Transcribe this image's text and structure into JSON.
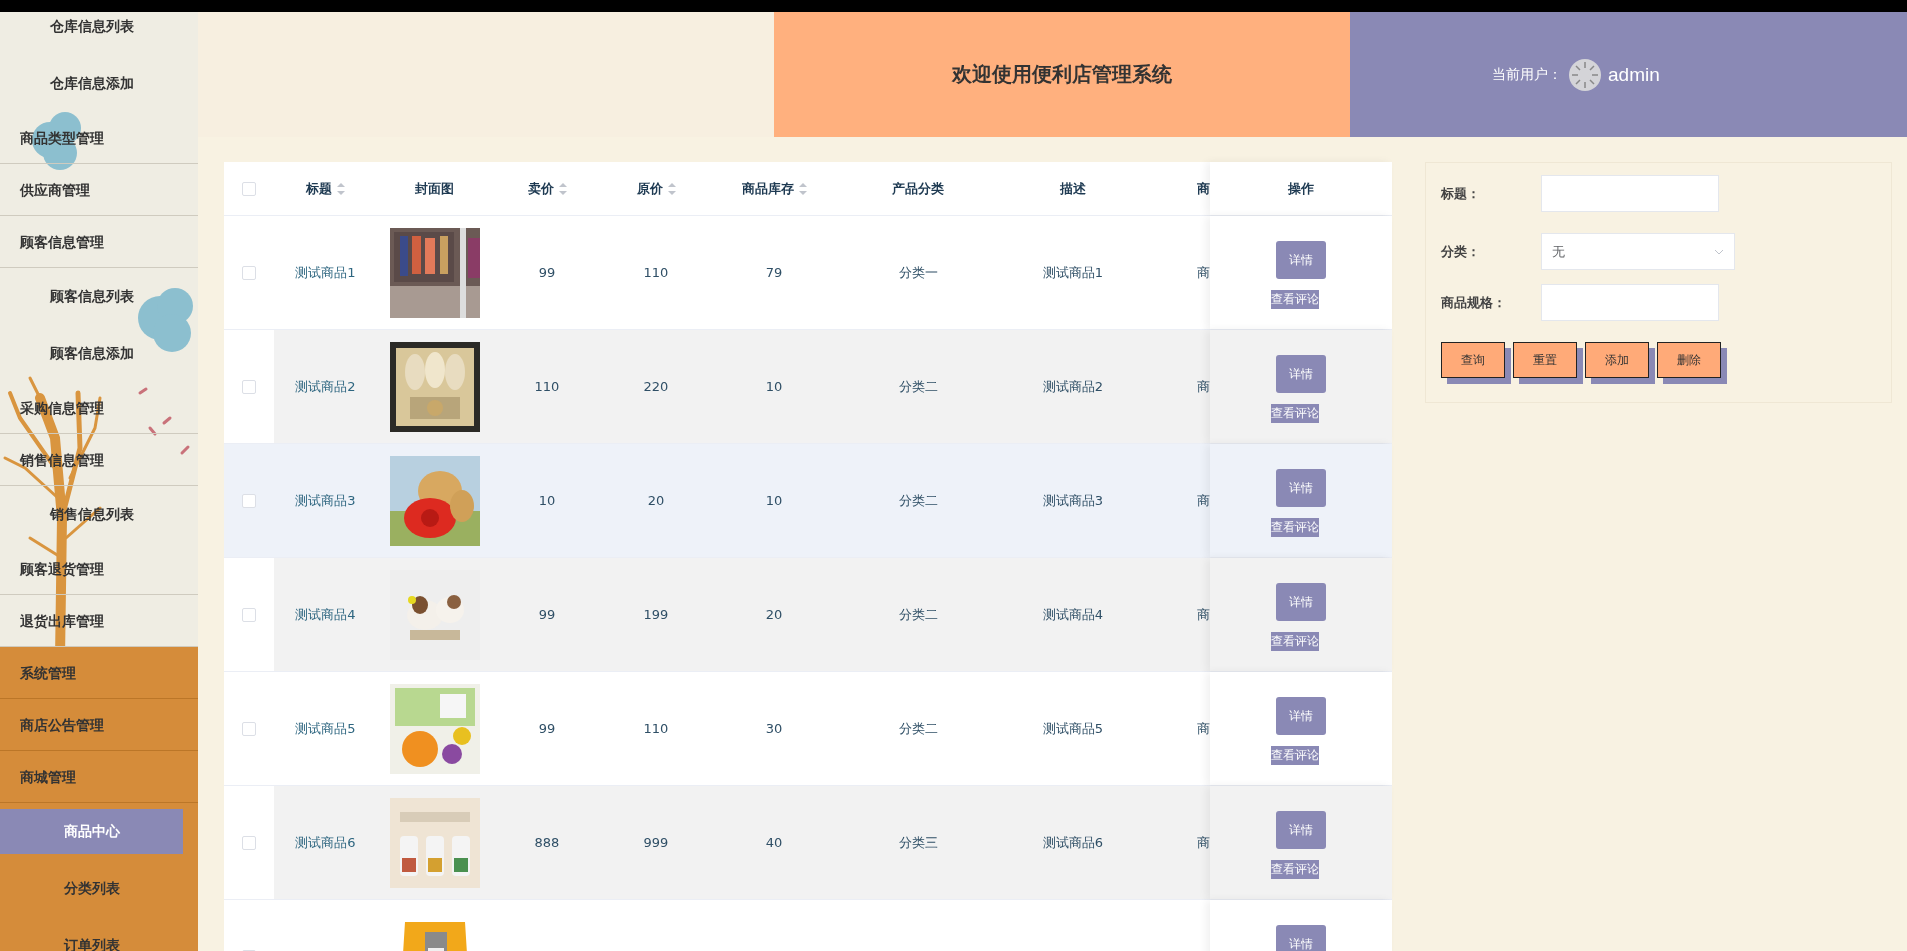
{
  "header": {
    "title": "欢迎使用便利店管理系统",
    "user_label": "当前用户：",
    "username": "admin"
  },
  "sidebar": {
    "upper": [
      {
        "label": "仓库信息列表",
        "kind": "sub",
        "selected": false
      },
      {
        "label": "仓库信息添加",
        "kind": "sub",
        "selected": false
      },
      {
        "label": "商品类型管理",
        "kind": "group"
      },
      {
        "label": "供应商管理",
        "kind": "group"
      },
      {
        "label": "顾客信息管理",
        "kind": "group",
        "children": [
          {
            "label": "顾客信息列表",
            "kind": "sub",
            "selected": false
          },
          {
            "label": "顾客信息添加",
            "kind": "sub",
            "selected": false
          }
        ]
      },
      {
        "label": "采购信息管理",
        "kind": "group"
      },
      {
        "label": "销售信息管理",
        "kind": "group",
        "children": [
          {
            "label": "销售信息列表",
            "kind": "sub",
            "selected": false
          }
        ]
      },
      {
        "label": "顾客退货管理",
        "kind": "group"
      },
      {
        "label": "退货出库管理",
        "kind": "group"
      }
    ],
    "lower": [
      {
        "label": "系统管理",
        "kind": "group"
      },
      {
        "label": "商店公告管理",
        "kind": "group"
      },
      {
        "label": "商城管理",
        "kind": "group",
        "children": [
          {
            "label": "商品中心",
            "kind": "sub",
            "selected": true
          },
          {
            "label": "分类列表",
            "kind": "sub",
            "selected": false
          },
          {
            "label": "订单列表",
            "kind": "sub",
            "selected": false
          }
        ]
      }
    ]
  },
  "table": {
    "select_all": {
      "checked": false
    },
    "columns": [
      {
        "label": "标题",
        "sortable": true
      },
      {
        "label": "封面图",
        "sortable": false
      },
      {
        "label": "卖价",
        "sortable": true
      },
      {
        "label": "原价",
        "sortable": true
      },
      {
        "label": "商品库存",
        "sortable": true
      },
      {
        "label": "产品分类",
        "sortable": false
      },
      {
        "label": "描述",
        "sortable": false
      },
      {
        "label": "商",
        "sortable": false
      },
      {
        "label": "操作",
        "sortable": false
      }
    ],
    "rows": [
      {
        "checked": false,
        "highlighted": false,
        "title": "测试商品1",
        "cover": {
          "kind": "picture"
        },
        "price": "99",
        "original_price": "110",
        "stock": "79",
        "category": "分类一",
        "description": "测试商品1",
        "column_8": "商",
        "actions": [
          "详情",
          "查看评论"
        ]
      },
      {
        "checked": false,
        "highlighted": false,
        "title": "测试商品2",
        "cover": {
          "kind": "picture"
        },
        "price": "110",
        "original_price": "220",
        "stock": "10",
        "category": "分类二",
        "description": "测试商品2",
        "column_8": "商",
        "actions": [
          "详情",
          "查看评论"
        ]
      },
      {
        "checked": false,
        "highlighted": true,
        "title": "测试商品3",
        "cover": {
          "kind": "picture"
        },
        "price": "10",
        "original_price": "20",
        "stock": "10",
        "category": "分类二",
        "description": "测试商品3",
        "column_8": "商",
        "actions": [
          "详情",
          "查看评论"
        ]
      },
      {
        "checked": false,
        "highlighted": false,
        "title": "测试商品4",
        "cover": {
          "kind": "picture"
        },
        "price": "99",
        "original_price": "199",
        "stock": "20",
        "category": "分类二",
        "description": "测试商品4",
        "column_8": "商",
        "actions": [
          "详情",
          "查看评论"
        ]
      },
      {
        "checked": false,
        "highlighted": false,
        "title": "测试商品5",
        "cover": {
          "kind": "picture"
        },
        "price": "99",
        "original_price": "110",
        "stock": "30",
        "category": "分类二",
        "description": "测试商品5",
        "column_8": "商",
        "actions": [
          "详情",
          "查看评论"
        ]
      },
      {
        "checked": false,
        "highlighted": false,
        "title": "测试商品6",
        "cover": {
          "kind": "picture"
        },
        "price": "888",
        "original_price": "999",
        "stock": "40",
        "category": "分类三",
        "description": "测试商品6",
        "column_8": "商",
        "actions": [
          "详情",
          "查看评论"
        ]
      },
      {
        "checked": false,
        "highlighted": false,
        "cover": {
          "kind": "picture"
        },
        "actions": [
          "详情"
        ]
      }
    ]
  },
  "search": {
    "fields": [
      {
        "label": "标题：",
        "kind": "text"
      },
      {
        "label": "分类：",
        "kind": "select",
        "value": "无"
      },
      {
        "label": "商品规格：",
        "kind": "text"
      }
    ],
    "buttons": [
      "查询",
      "重置",
      "添加",
      "删除"
    ]
  }
}
